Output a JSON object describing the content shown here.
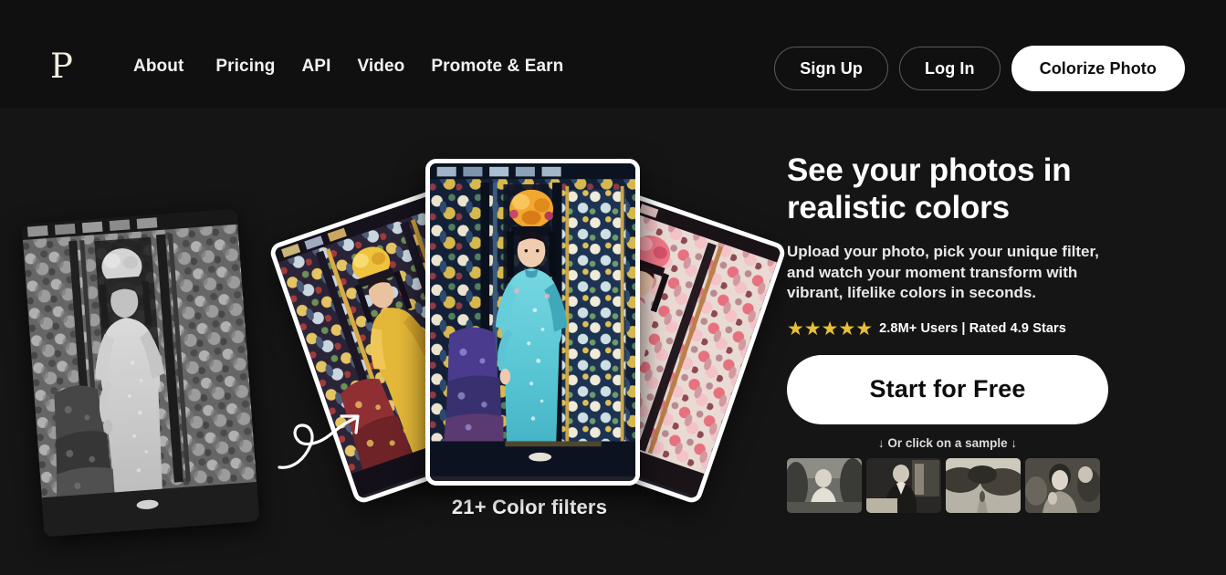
{
  "brand": {
    "logo_letter": "P"
  },
  "nav": {
    "links": [
      {
        "label": "About"
      },
      {
        "label": "Pricing"
      },
      {
        "label": "API"
      },
      {
        "label": "Video"
      },
      {
        "label": "Promote & Earn"
      }
    ],
    "auth": {
      "sign_up": "Sign Up",
      "log_in": "Log In",
      "colorize": "Colorize Photo"
    }
  },
  "hero": {
    "headline": "See your photos in realistic colors",
    "subhead": "Upload your photo, pick your unique filter, and watch your moment transform with vibrant, lifelike colors in seconds.",
    "rating": {
      "stars": "★★★★★",
      "star_count": 5,
      "text": "2.8M+ Users | Rated 4.9 Stars",
      "star_color": "#e6c036"
    },
    "cta_label": "Start for Free",
    "sample_hint": "↓ Or click on a sample ↓",
    "samples": [
      {
        "name": "sample-woman-garden"
      },
      {
        "name": "sample-man-desk"
      },
      {
        "name": "sample-landscape-path"
      },
      {
        "name": "sample-family-portrait"
      }
    ]
  },
  "showcase": {
    "bw_photo_alt": "black-and-white portrait of woman in qipao",
    "filters_caption": "21+ Color filters",
    "cards": [
      {
        "name": "card-filter-warm-yellow"
      },
      {
        "name": "card-filter-cyan-main"
      },
      {
        "name": "card-filter-pink-red"
      }
    ],
    "arrow_label": "curly-arrow-pointing-to-cards"
  },
  "colors": {
    "page_bg": "#151515",
    "header_bg": "#101010",
    "accent_white": "#ffffff",
    "logo_cream": "#f4eee0"
  }
}
